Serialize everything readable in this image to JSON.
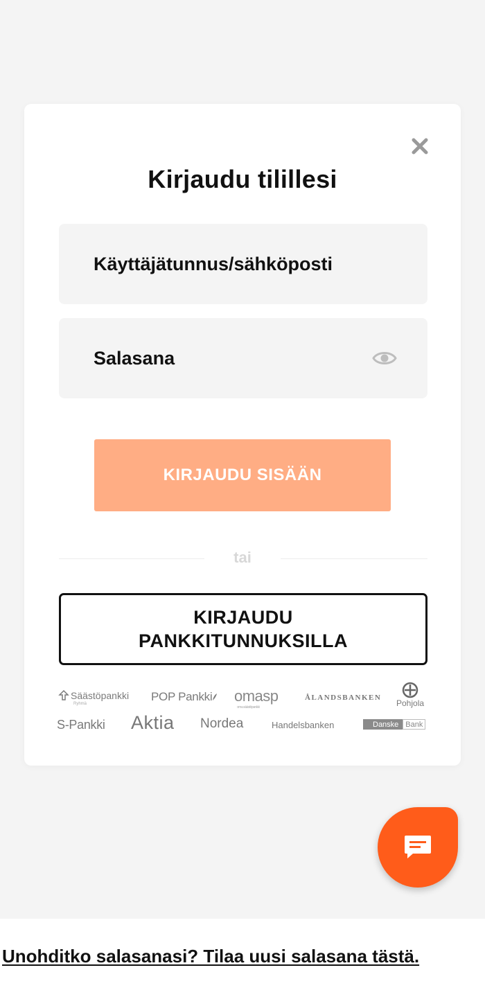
{
  "modal": {
    "title": "Kirjaudu tilillesi",
    "username_placeholder": "Käyttäjätunnus/sähköposti",
    "username_value": "",
    "password_placeholder": "Salasana",
    "password_value": "",
    "login_button": "KIRJAUDU SISÄÄN",
    "divider_text": "tai",
    "bank_button": "KIRJAUDU\nPANKKITUNNUKSILLA",
    "icons": {
      "close": "close-icon",
      "password_toggle": "eye-icon",
      "chat": "chat-bubble-icon"
    },
    "bank_logos": {
      "saastopankki": "Säästöpankki",
      "saastopankki_sub": "Ryhmä",
      "poppankki": "POP Pankki",
      "omasp": "omasp",
      "omasp_sub": "oma säästöpankki",
      "alandsbanken": "ÅLANDSBANKEN",
      "pohjola": "Pohjola",
      "spankki": "S-Pankki",
      "aktia": "Aktia",
      "nordea": "Nordea",
      "handelsbanken": "Handelsbanken",
      "danske_part1": "Danske",
      "danske_part2": "Bank"
    }
  },
  "footer": {
    "forgot_password_link": "Unohditko salasanasi? Tilaa uusi salasana tästä."
  },
  "colors": {
    "login_button_bg": "#ffad84",
    "chat_button_bg": "#ff5c1a",
    "field_bg": "#f4f4f4",
    "page_bg": "#f4f4f4"
  }
}
